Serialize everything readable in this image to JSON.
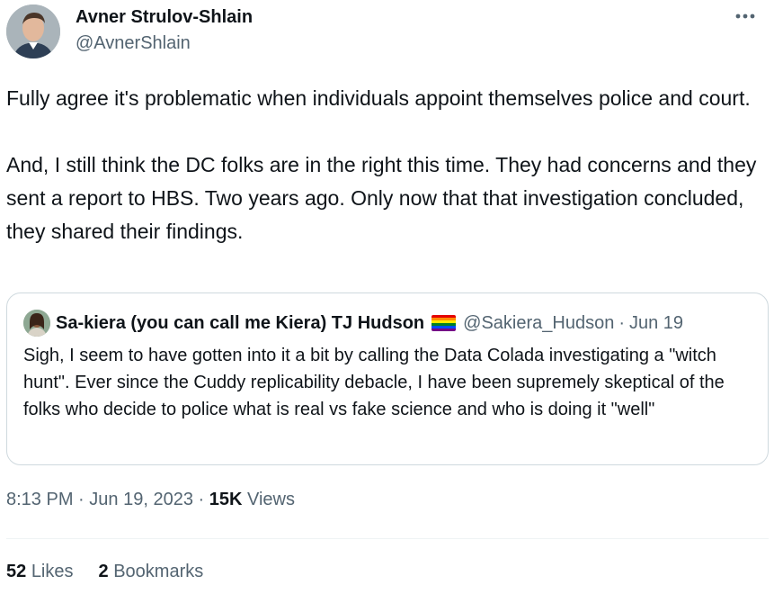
{
  "tweet": {
    "author": {
      "name": "Avner Strulov-Shlain",
      "handle": "@AvnerShlain"
    },
    "more_icon": "more-horizontal-icon",
    "paragraphs": [
      "Fully agree it's problematic when individuals appoint themselves police and court.",
      "And, I still think the DC folks are in the right this time. They had concerns and they sent a report to HBS. Two years ago. Only now that that investigation concluded, they shared their findings."
    ],
    "quote": {
      "name": "Sa-kiera (you can call me Kiera) TJ Hudson",
      "flag_icon": "rainbow-flag-icon",
      "handle": "@Sakiera_Hudson",
      "separator": "·",
      "date": "Jun 19",
      "text": "Sigh, I seem to have gotten into it a bit by calling the Data Colada investigating a \"witch hunt\". Ever since the Cuddy replicability debacle, I have been supremely skeptical of the folks who decide to police what is real vs fake science and who is doing it \"well\""
    },
    "meta": {
      "time": "8:13 PM",
      "separator": "·",
      "date": "Jun 19, 2023",
      "views_count": "15K",
      "views_label": "Views"
    },
    "stats": {
      "likes_count": "52",
      "likes_label": "Likes",
      "bookmarks_count": "2",
      "bookmarks_label": "Bookmarks"
    },
    "colors": {
      "text_primary": "#0f1419",
      "text_secondary": "#536471",
      "border": "#cfd9de"
    }
  }
}
